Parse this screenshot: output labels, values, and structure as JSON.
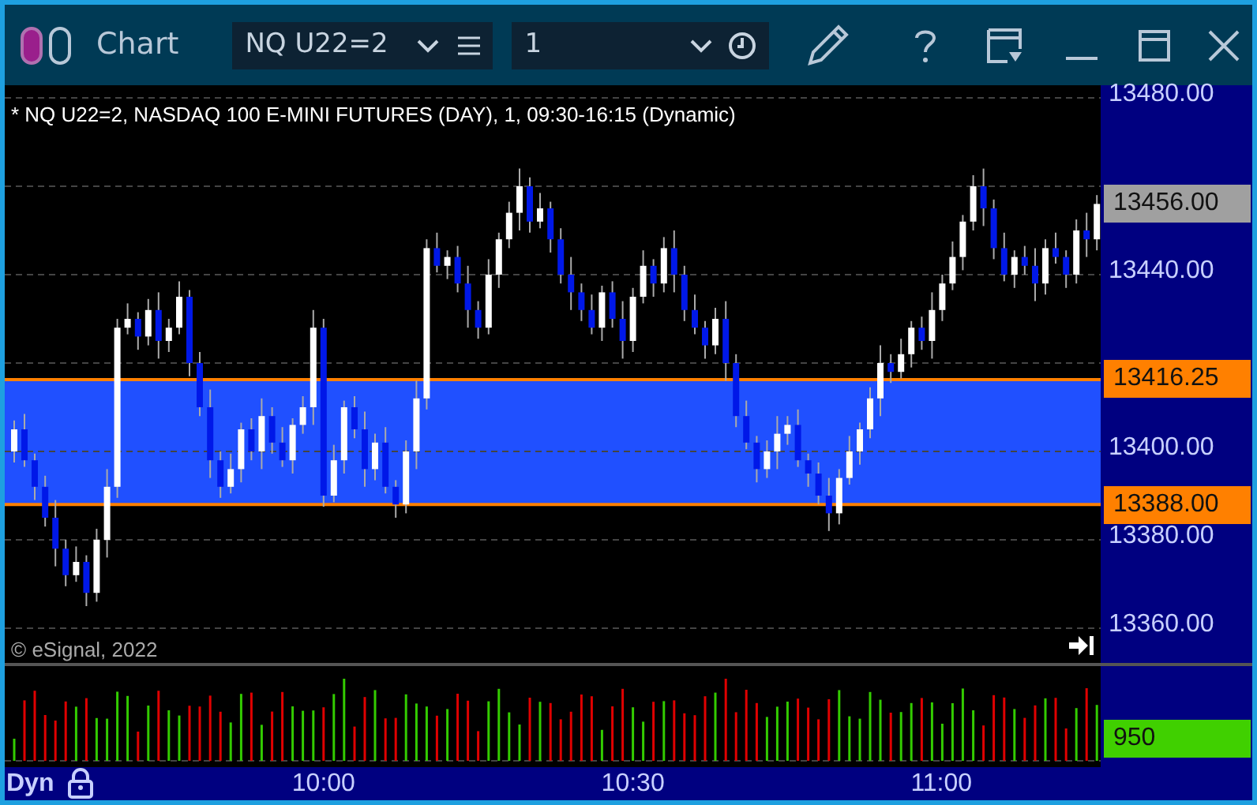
{
  "window": {
    "title": "Chart"
  },
  "toolbar": {
    "symbol": "NQ U22=2",
    "interval": "1"
  },
  "chart": {
    "legend": "* NQ U22=2, NASDAQ 100 E-MINI FUTURES (DAY), 1, 09:30-16:15 (Dynamic)",
    "copyright": "© eSignal, 2022",
    "last_price": "13456.00",
    "volume_label": "950",
    "mode": "Dyn",
    "chart_data": {
      "type": "candlestick",
      "x": [
        9.5,
        9.5167,
        9.5333,
        9.55,
        9.5667,
        9.5833,
        9.6,
        9.6167,
        9.6333,
        9.65,
        9.6667,
        9.6833,
        9.7,
        9.7167,
        9.7333,
        9.75,
        9.7667,
        9.7833,
        9.8,
        9.8167,
        9.8333,
        9.85,
        9.8667,
        9.8833,
        9.9,
        9.9167,
        9.9333,
        9.95,
        9.9667,
        9.9833,
        10,
        10.0167,
        10.0333,
        10.05,
        10.0667,
        10.0833,
        10.1,
        10.1167,
        10.1333,
        10.15,
        10.1667,
        10.1833,
        10.2,
        10.2167,
        10.2333,
        10.25,
        10.2667,
        10.2833,
        10.3,
        10.3167,
        10.3333,
        10.35,
        10.3667,
        10.3833,
        10.4,
        10.4167,
        10.4333,
        10.45,
        10.4667,
        10.4833,
        10.5,
        10.5167,
        10.5333,
        10.55,
        10.5667,
        10.5833,
        10.6,
        10.6167,
        10.6333,
        10.65,
        10.6667,
        10.6833,
        10.7,
        10.7167,
        10.7333,
        10.75,
        10.7667,
        10.7833,
        10.8,
        10.8167,
        10.8333,
        10.85,
        10.8667,
        10.8833,
        10.9,
        10.9167,
        10.9333,
        10.95,
        10.9667,
        10.9833,
        11,
        11.0167,
        11.0333,
        11.05,
        11.0667,
        11.0833,
        11.1,
        11.1167,
        11.1333,
        11.15,
        11.1667,
        11.1833,
        11.2,
        11.2167,
        11.2333,
        11.25
      ],
      "ohlc": [
        [
          13400,
          13407,
          13397.5,
          13405
        ],
        [
          13405,
          13408.5,
          13396.5,
          13398
        ],
        [
          13398,
          13399.5,
          13389,
          13392
        ],
        [
          13392,
          13394.5,
          13383,
          13385
        ],
        [
          13385,
          13389,
          13374,
          13378
        ],
        [
          13378,
          13380,
          13369.5,
          13372
        ],
        [
          13372,
          13378.5,
          13370.5,
          13375
        ],
        [
          13375,
          13376.5,
          13365,
          13368
        ],
        [
          13368,
          13382.5,
          13366,
          13380
        ],
        [
          13380,
          13396,
          13376,
          13392
        ],
        [
          13392,
          13430,
          13389.5,
          13428
        ],
        [
          13428,
          13433.5,
          13426.5,
          13430
        ],
        [
          13430,
          13431.5,
          13423,
          13426
        ],
        [
          13426,
          13434.5,
          13424,
          13432
        ],
        [
          13432,
          13436,
          13421,
          13425
        ],
        [
          13425,
          13430,
          13422.5,
          13428
        ],
        [
          13428,
          13438.5,
          13426.5,
          13435
        ],
        [
          13435,
          13436.5,
          13417,
          13420
        ],
        [
          13420,
          13422.5,
          13408,
          13410
        ],
        [
          13410,
          13414,
          13394,
          13398
        ],
        [
          13398,
          13400,
          13389.5,
          13392
        ],
        [
          13392,
          13399.5,
          13390.5,
          13396
        ],
        [
          13396,
          13406.5,
          13393,
          13405
        ],
        [
          13405,
          13407.5,
          13398,
          13400
        ],
        [
          13400,
          13412,
          13396,
          13408
        ],
        [
          13408,
          13410,
          13399.5,
          13402
        ],
        [
          13402,
          13405.5,
          13396.5,
          13398
        ],
        [
          13398,
          13407.5,
          13395,
          13406
        ],
        [
          13406,
          13412.5,
          13404,
          13410
        ],
        [
          13410,
          13432,
          13406,
          13428
        ],
        [
          13428,
          13430,
          13387.5,
          13390
        ],
        [
          13390,
          13401.5,
          13388.5,
          13398
        ],
        [
          13398,
          13411.5,
          13395,
          13410
        ],
        [
          13410,
          13412.5,
          13403,
          13405
        ],
        [
          13405,
          13409,
          13392,
          13396
        ],
        [
          13396,
          13404,
          13393.5,
          13402
        ],
        [
          13402,
          13405.5,
          13390.5,
          13392
        ],
        [
          13392,
          13393.5,
          13385,
          13388
        ],
        [
          13388,
          13402.5,
          13386,
          13400
        ],
        [
          13400,
          13416,
          13396,
          13412
        ],
        [
          13412,
          13448,
          13409.5,
          13446
        ],
        [
          13446,
          13449.5,
          13440.5,
          13442
        ],
        [
          13442,
          13445.5,
          13439,
          13444
        ],
        [
          13444,
          13446.5,
          13436,
          13438
        ],
        [
          13438,
          13442,
          13428,
          13432
        ],
        [
          13432,
          13434,
          13425.5,
          13428
        ],
        [
          13428,
          13443.5,
          13426.5,
          13440
        ],
        [
          13440,
          13449.5,
          13437,
          13448
        ],
        [
          13448,
          13456.5,
          13446,
          13454
        ],
        [
          13454,
          13464,
          13450,
          13460
        ],
        [
          13460,
          13462,
          13449.5,
          13452
        ],
        [
          13452,
          13458.5,
          13450.5,
          13455
        ],
        [
          13455,
          13456.5,
          13445,
          13448
        ],
        [
          13448,
          13450.5,
          13438,
          13440
        ],
        [
          13440,
          13444,
          13432,
          13436
        ],
        [
          13436,
          13438,
          13429.5,
          13432
        ],
        [
          13432,
          13435.5,
          13426.5,
          13428
        ],
        [
          13428,
          13437.5,
          13425,
          13436
        ],
        [
          13436,
          13438.5,
          13428,
          13430
        ],
        [
          13430,
          13434,
          13421,
          13425
        ],
        [
          13425,
          13437,
          13422.5,
          13435
        ],
        [
          13435,
          13445.5,
          13433.5,
          13442
        ],
        [
          13442,
          13443.5,
          13435,
          13438
        ],
        [
          13438,
          13448.5,
          13436,
          13446
        ],
        [
          13446,
          13450,
          13436,
          13440
        ],
        [
          13440,
          13442,
          13429.5,
          13432
        ],
        [
          13432,
          13435.5,
          13426.5,
          13428
        ],
        [
          13428,
          13429.5,
          13421,
          13424
        ],
        [
          13424,
          13432.5,
          13422,
          13430
        ],
        [
          13430,
          13434,
          13416,
          13420
        ],
        [
          13420,
          13422,
          13405.5,
          13408
        ],
        [
          13408,
          13411.5,
          13400.5,
          13402
        ],
        [
          13402,
          13403.5,
          13393,
          13396
        ],
        [
          13396,
          13402.5,
          13394,
          13400
        ],
        [
          13400,
          13408,
          13396,
          13404
        ],
        [
          13404,
          13408,
          13401.5,
          13406
        ],
        [
          13406,
          13409.5,
          13396.5,
          13398
        ],
        [
          13398,
          13399.5,
          13392,
          13395
        ],
        [
          13395,
          13397.5,
          13388,
          13390
        ],
        [
          13390,
          13394,
          13382,
          13386
        ],
        [
          13386,
          13396,
          13383.5,
          13394
        ],
        [
          13394,
          13403.5,
          13392.5,
          13400
        ],
        [
          13400,
          13406.5,
          13397,
          13405
        ],
        [
          13405,
          13414.5,
          13403,
          13412
        ],
        [
          13412,
          13424,
          13408,
          13420
        ],
        [
          13420,
          13422,
          13415.5,
          13418
        ],
        [
          13418,
          13425.5,
          13416.5,
          13422
        ],
        [
          13422,
          13429.5,
          13419,
          13428
        ],
        [
          13428,
          13430.5,
          13423,
          13425
        ],
        [
          13425,
          13436,
          13421,
          13432
        ],
        [
          13432,
          13440,
          13429.5,
          13438
        ],
        [
          13438,
          13447.5,
          13436.5,
          13444
        ],
        [
          13444,
          13453.5,
          13441,
          13452
        ],
        [
          13452,
          13462.5,
          13450,
          13460
        ],
        [
          13460,
          13464,
          13451,
          13455
        ],
        [
          13455,
          13457,
          13443.5,
          13446
        ],
        [
          13446,
          13449.5,
          13438.5,
          13440
        ],
        [
          13440,
          13445.5,
          13437,
          13444
        ],
        [
          13444,
          13446.5,
          13440,
          13442
        ],
        [
          13442,
          13446,
          13434,
          13438
        ],
        [
          13438,
          13448,
          13435.5,
          13446
        ],
        [
          13446,
          13449.5,
          13442.5,
          13444
        ],
        [
          13444,
          13445.5,
          13437,
          13440
        ],
        [
          13440,
          13452.5,
          13438,
          13450
        ],
        [
          13450,
          13454,
          13444,
          13448
        ],
        [
          13448,
          13458,
          13445.5,
          13456
        ]
      ],
      "ylim": [
        13352.14,
        13482.86
      ],
      "xticks": [
        {
          "value": 10,
          "label": "10:00"
        },
        {
          "value": 10.5,
          "label": "10:30"
        },
        {
          "value": 11,
          "label": "11:00"
        }
      ],
      "grid": true,
      "xlim": [
        9.4847,
        11.256
      ],
      "bands": [
        {
          "axis": "y",
          "from": 13388,
          "to": 13416.25,
          "color": "#2050ff"
        }
      ],
      "ref_lines": [
        {
          "axis": "y",
          "value": 13416.25,
          "label": "13416.25",
          "color": "#ff8000"
        },
        {
          "axis": "y",
          "value": 13388,
          "label": "13388.00",
          "color": "#ff8000"
        }
      ],
      "yticks": [
        {
          "value": 13480,
          "label": "13480.00"
        },
        {
          "value": 13440,
          "label": "13440.00"
        },
        {
          "value": 13400,
          "label": "13400.00"
        },
        {
          "value": 13380,
          "label": "13380.00"
        },
        {
          "value": 13360,
          "label": "13360.00"
        }
      ]
    }
  }
}
